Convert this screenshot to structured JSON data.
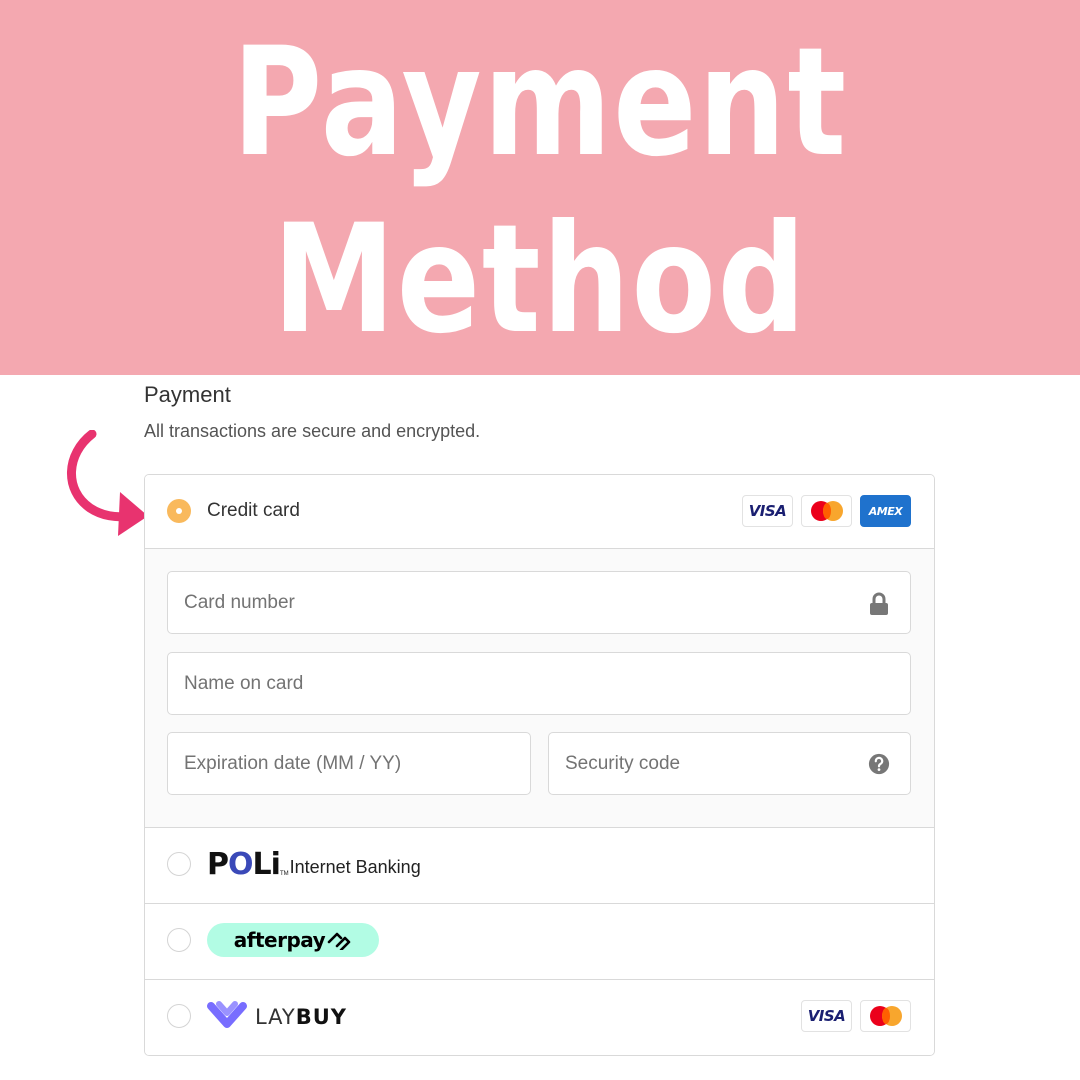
{
  "banner": {
    "title_line1": "Payment",
    "title_line2": "Method",
    "background": "#f4a8b0"
  },
  "section": {
    "heading": "Payment",
    "subheading": "All transactions are secure and encrypted."
  },
  "payment_methods": [
    {
      "id": "credit-card",
      "label": "Credit card",
      "selected": true,
      "card_logos": [
        "VISA",
        "Mastercard",
        "AMEX"
      ]
    },
    {
      "id": "poli",
      "logo_text": "POLi",
      "trademark": "TM",
      "label": "Internet Banking",
      "selected": false
    },
    {
      "id": "afterpay",
      "logo_text": "afterpay",
      "selected": false
    },
    {
      "id": "laybuy",
      "logo_text_light": "LAY",
      "logo_text_bold": "BUY",
      "selected": false,
      "card_logos": [
        "VISA",
        "Mastercard"
      ]
    }
  ],
  "card_logos": {
    "visa": "VISA",
    "amex": "AMEX"
  },
  "card_form": {
    "card_number_placeholder": "Card number",
    "name_placeholder": "Name on card",
    "expiry_placeholder": "Expiration date (MM / YY)",
    "security_code_placeholder": "Security code"
  },
  "colors": {
    "accent_radio": "#f9b95c",
    "arrow": "#e8336f",
    "afterpay_mint": "#b2fce4",
    "laybuy_purple": "#786dff",
    "amex_blue": "#1f72cd"
  }
}
